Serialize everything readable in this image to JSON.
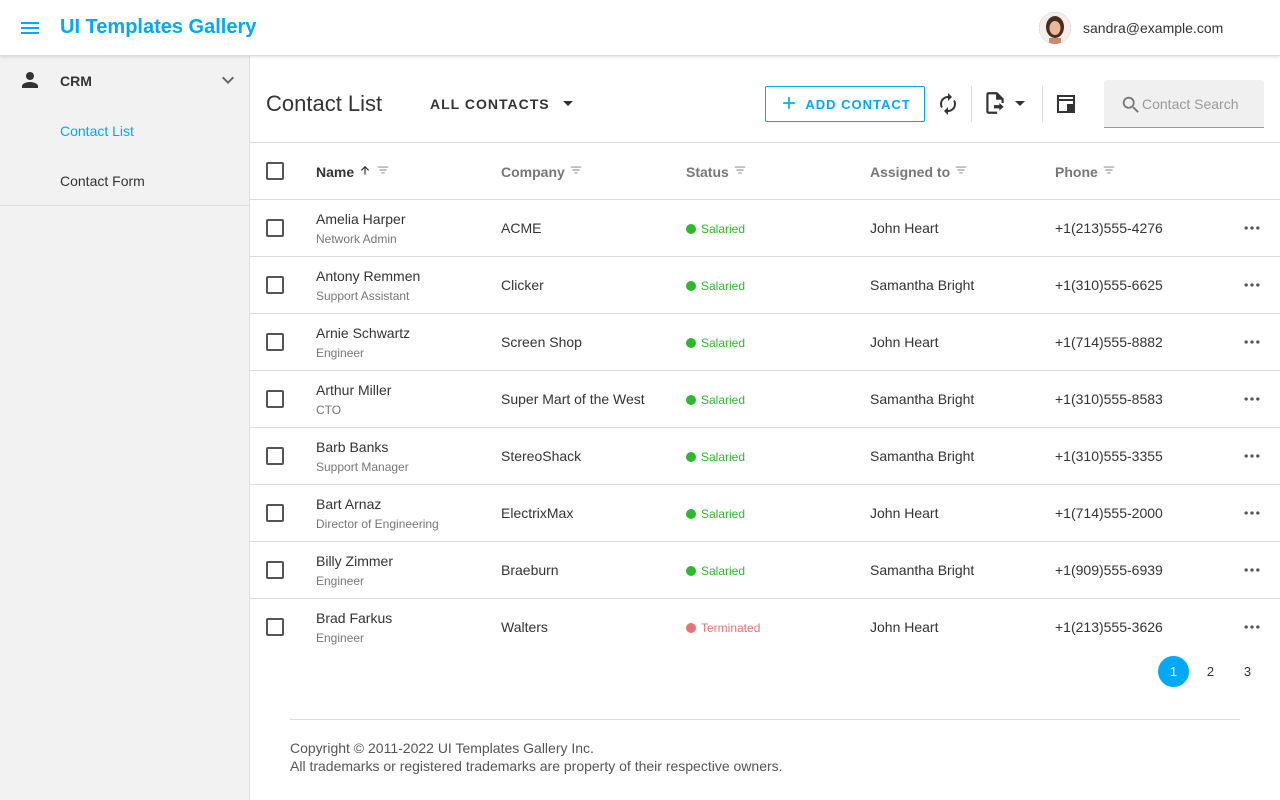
{
  "header": {
    "app_title": "UI Templates Gallery",
    "user_email": "sandra@example.com",
    "menu_icon": "menu-icon",
    "avatar_icon": "avatar"
  },
  "sidebar": {
    "group_label": "CRM",
    "items": [
      {
        "label": "Contact List",
        "active": true
      },
      {
        "label": "Contact Form",
        "active": false
      }
    ]
  },
  "toolbar": {
    "page_title": "Contact List",
    "filter_label": "ALL CONTACTS",
    "add_label": "ADD CONTACT",
    "search_placeholder": "Contact Search",
    "search_value": ""
  },
  "table": {
    "columns": [
      "Name",
      "Company",
      "Status",
      "Assigned to",
      "Phone"
    ],
    "sorted_column": "Name",
    "sort_direction": "ascending",
    "rows": [
      {
        "name": "Amelia Harper",
        "position": "Network Admin",
        "company": "ACME",
        "status": "Salaried",
        "assigned": "John Heart",
        "phone": "+1(213)555-4276"
      },
      {
        "name": "Antony Remmen",
        "position": "Support Assistant",
        "company": "Clicker",
        "status": "Salaried",
        "assigned": "Samantha Bright",
        "phone": "+1(310)555-6625"
      },
      {
        "name": "Arnie Schwartz",
        "position": "Engineer",
        "company": "Screen Shop",
        "status": "Salaried",
        "assigned": "John Heart",
        "phone": "+1(714)555-8882"
      },
      {
        "name": "Arthur Miller",
        "position": "CTO",
        "company": "Super Mart of the West",
        "status": "Salaried",
        "assigned": "Samantha Bright",
        "phone": "+1(310)555-8583"
      },
      {
        "name": "Barb Banks",
        "position": "Support Manager",
        "company": "StereoShack",
        "status": "Salaried",
        "assigned": "Samantha Bright",
        "phone": "+1(310)555-3355"
      },
      {
        "name": "Bart Arnaz",
        "position": "Director of Engineering",
        "company": "ElectrixMax",
        "status": "Salaried",
        "assigned": "John Heart",
        "phone": "+1(714)555-2000"
      },
      {
        "name": "Billy Zimmer",
        "position": "Engineer",
        "company": "Braeburn",
        "status": "Salaried",
        "assigned": "Samantha Bright",
        "phone": "+1(909)555-6939"
      },
      {
        "name": "Brad Farkus",
        "position": "Engineer",
        "company": "Walters",
        "status": "Terminated",
        "assigned": "John Heart",
        "phone": "+1(213)555-3626"
      }
    ]
  },
  "pagination": {
    "pages": [
      "1",
      "2",
      "3"
    ],
    "current": "1"
  },
  "footer": {
    "copyright": "Copyright © 2011-2022 UI Templates Gallery Inc.",
    "trademark": "All trademarks or registered trademarks are property of their respective owners."
  },
  "colors": {
    "accent": "#03a9f4",
    "salaried": "#2eb82e",
    "terminated": "#e57373"
  }
}
